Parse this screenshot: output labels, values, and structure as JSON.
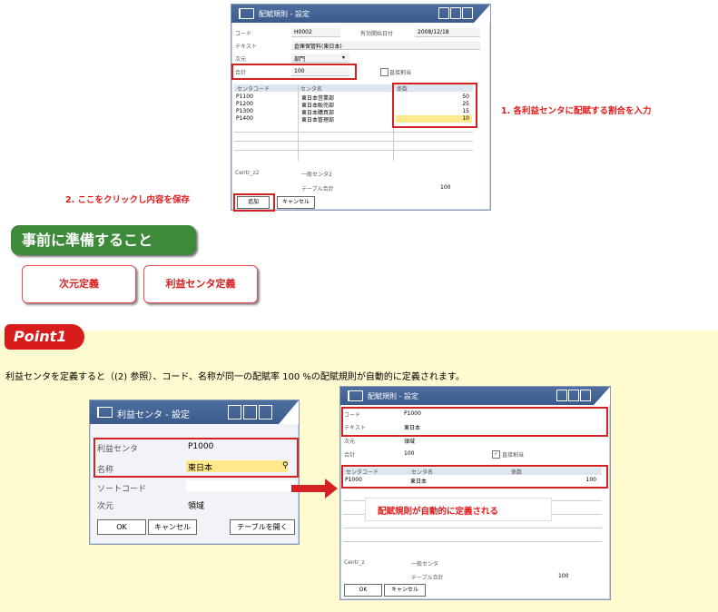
{
  "win1": {
    "title": "配賦規則 - 設定",
    "code_label": "コード",
    "code_value": "H0002",
    "valid_from_label": "有効開始日付",
    "valid_from_value": "2008/12/18",
    "text_label": "テキスト",
    "text_value": "倉庫保管料(東日本)",
    "dim_label": "次元",
    "dim_value": "部門",
    "total_label": "合計",
    "total_value": "100",
    "direct_label": "直接割当",
    "col_code": "センタコード",
    "col_name": "センタ名",
    "col_rate": "係数",
    "rows": [
      {
        "code": "P1100",
        "name": "東日本営業部",
        "rate": "50"
      },
      {
        "code": "P1200",
        "name": "東日本販売部",
        "rate": "25"
      },
      {
        "code": "P1300",
        "name": "東日本購買部",
        "rate": "15"
      },
      {
        "code": "P1400",
        "name": "東日本管理部",
        "rate": "10"
      }
    ],
    "centr_label": "Centr_z2",
    "centr_value": "一般センタ2",
    "table_total_label": "テーブル合計",
    "table_total_value": "100",
    "add_btn": "追加",
    "cancel_btn": "キャンセル"
  },
  "callout1": "1. 各利益センタに配賦する割合を入力",
  "callout2": "2. ここをクリックし内容を保存",
  "prep_heading": "事前に準備すること",
  "prep_btn1": "次元定義",
  "prep_btn2": "利益センタ定義",
  "point_label": "Point1",
  "point_text": "利益センタを定義すると（(2) 参照）、コード、名称が同一の配賦率 100 %の配賦規則が自動的に定義されます。",
  "win2": {
    "title": "利益センタ - 設定",
    "pc_label": "利益センタ",
    "pc_value": "P1000",
    "name_label": "名称",
    "name_value": "東日本",
    "sort_label": "ソートコード",
    "sort_value": "",
    "dim_label": "次元",
    "dim_value": "領域",
    "ok_btn": "OK",
    "cancel_btn": "キャンセル",
    "table_btn": "テーブルを開く"
  },
  "win3": {
    "title": "配賦規則 - 設定",
    "code_label": "コード",
    "code_value": "P1000",
    "text_label": "テキスト",
    "text_value": "東日本",
    "dim_label": "次元",
    "dim_value": "領域",
    "total_label": "合計",
    "total_value": "100",
    "direct_label": "直接割当",
    "col_code": "センタコード",
    "col_name": "センタ名",
    "col_rate": "係数",
    "row_code": "P1000",
    "row_name": "東日本",
    "row_rate": "100",
    "centr_label": "Centr_z",
    "centr_value": "一般センタ",
    "table_total_label": "テーブル合計",
    "table_total_value": "100",
    "ok_btn": "OK",
    "cancel_btn": "キャンセル"
  },
  "auto_callout": "配賦規則が自動的に定義される",
  "colors": {
    "accent_red": "#d42222",
    "green": "#3d8a3a",
    "yellow_bg": "#fffad0",
    "title_blue": "#3b5b8c"
  }
}
